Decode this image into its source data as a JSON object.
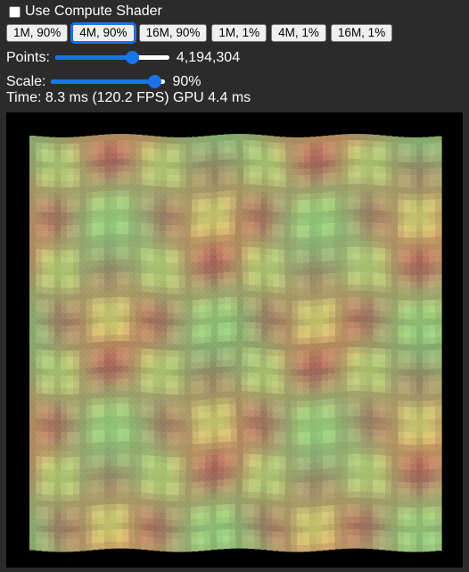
{
  "controls": {
    "compute_shader_label": "Use Compute Shader",
    "compute_shader_checked": false,
    "presets": [
      {
        "label": "1M, 90%",
        "active": false
      },
      {
        "label": "4M, 90%",
        "active": true
      },
      {
        "label": "16M, 90%",
        "active": false
      },
      {
        "label": "1M, 1%",
        "active": false
      },
      {
        "label": "4M, 1%",
        "active": false
      },
      {
        "label": "16M, 1%",
        "active": false
      }
    ],
    "points": {
      "label": "Points:",
      "value_text": "4,194,304",
      "level": 0.67
    },
    "scale": {
      "label": "Scale:",
      "value_text": "90%",
      "level": 0.9
    }
  },
  "stats": {
    "time_text": "Time: 8.3 ms (120.2 FPS) GPU 4.4 ms"
  },
  "colors": {
    "background": "#2b2b2b",
    "accent": "#1a73e8",
    "canvas_bg": "#000000",
    "wave_yellow": "#e8e27a",
    "wave_red": "#c85a5a",
    "wave_green": "#8fe08a"
  }
}
